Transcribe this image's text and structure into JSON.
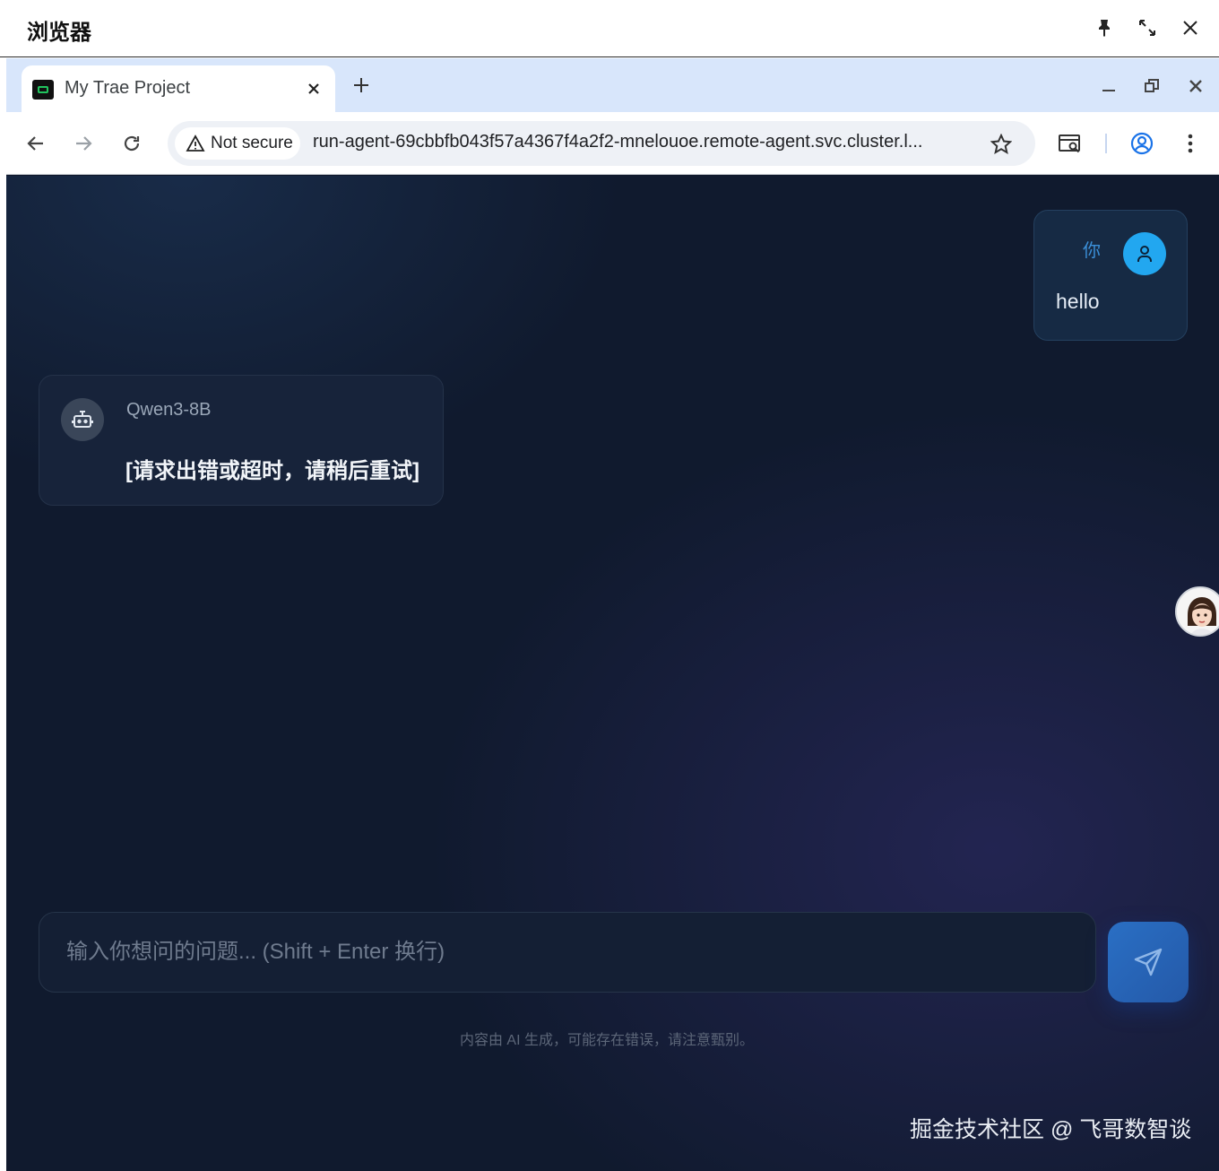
{
  "app": {
    "title": "浏览器"
  },
  "browser": {
    "tab": {
      "title": "My Trae Project"
    },
    "omnibox": {
      "security_label": "Not secure",
      "url": "run-agent-69cbbfb043f57a4367f4a2f2-mnelouoe.remote-agent.svc.cluster.l..."
    }
  },
  "chat": {
    "messages": [
      {
        "role": "user",
        "author": "你",
        "text": "hello"
      },
      {
        "role": "assistant",
        "author": "Qwen3-8B",
        "text": "[请求出错或超时，请稍后重试]"
      }
    ],
    "input": {
      "placeholder": "输入你想问的问题... (Shift + Enter 换行)",
      "value": ""
    },
    "disclaimer": "内容由 AI 生成，可能存在错误，请注意甄别。"
  },
  "watermark": "掘金技术社区 @ 飞哥数智谈",
  "colors": {
    "page_bg": "#101a2e",
    "accent": "#22a7f0",
    "send_button": "#2a6fc4"
  }
}
